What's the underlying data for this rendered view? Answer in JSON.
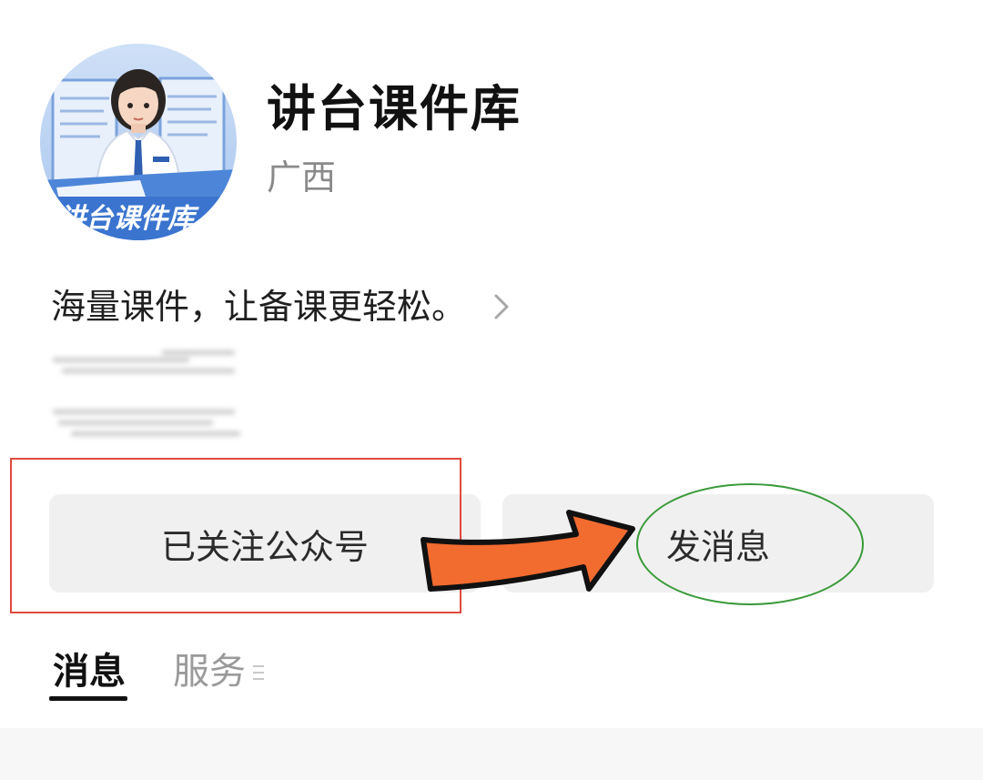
{
  "profile": {
    "name": "讲台课件库",
    "region": "广西",
    "avatar_caption": "讲台课件库",
    "intro": "海量课件，让备课更轻松。"
  },
  "actions": {
    "follow_label": "已关注公众号",
    "message_label": "发消息"
  },
  "tabs": [
    {
      "label": "消息",
      "active": true
    },
    {
      "label": "服务",
      "active": false
    }
  ],
  "icons": {
    "intro": "chevron-right-icon",
    "tab_menu": "menu-lines-icon"
  },
  "colors": {
    "annotation_box": "#e04a3f",
    "annotation_ellipse": "#3a9a3a",
    "annotation_arrow": "#f26b2f",
    "button_bg": "#f0f0f0"
  }
}
